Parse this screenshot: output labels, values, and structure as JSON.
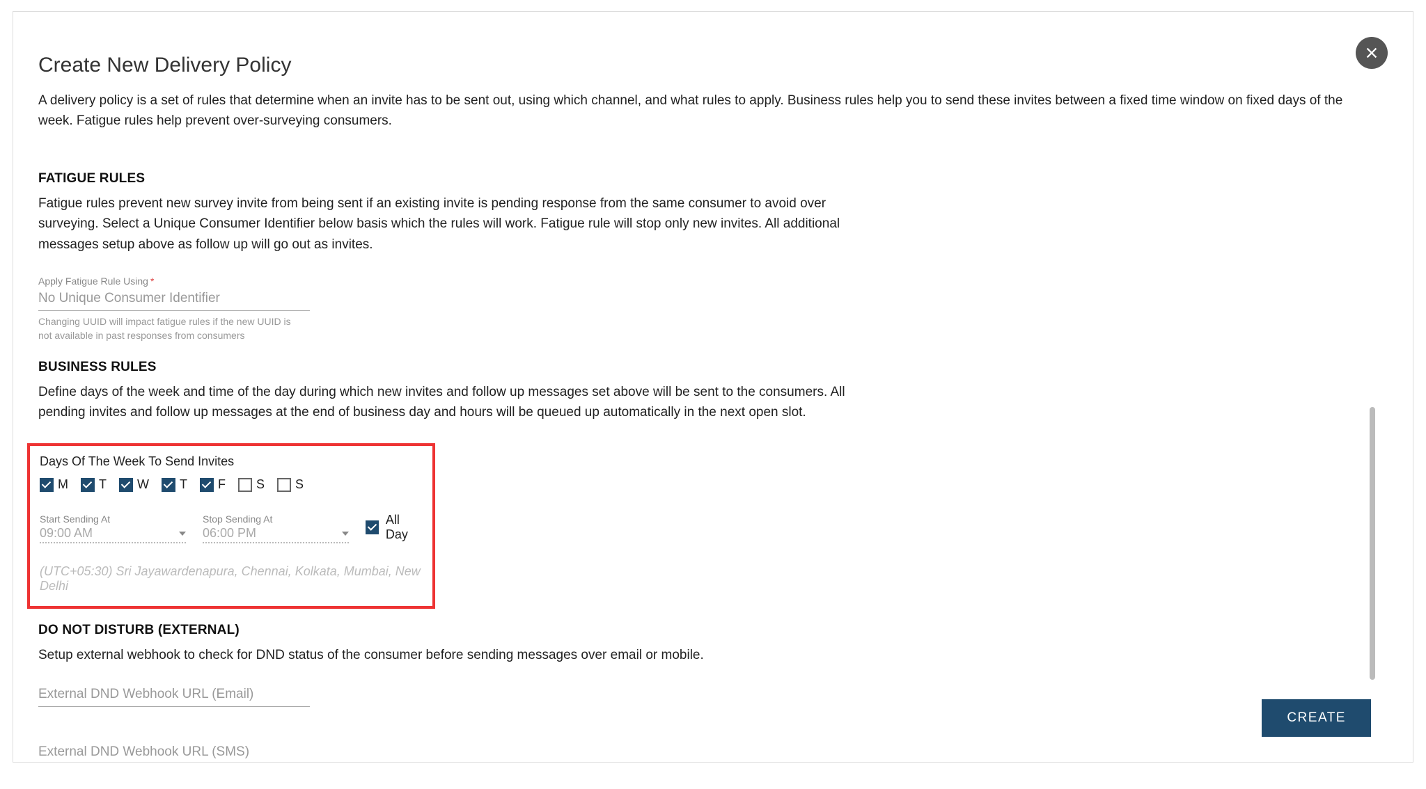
{
  "header": {
    "title": "Create New Delivery Policy",
    "description": "A delivery policy is a set of rules that determine when an invite has to be sent out, using which channel, and what rules to apply. Business rules help you to send these invites between a fixed time window on fixed days of the week. Fatigue rules help prevent over-surveying consumers."
  },
  "fatigue": {
    "heading": "FATIGUE RULES",
    "description": "Fatigue rules prevent new survey invite from being sent if an existing invite is pending response from the same consumer to avoid over surveying. Select a Unique Consumer Identifier below basis which the rules will work. Fatigue rule will stop only new invites. All additional messages setup above as follow up will go out as invites.",
    "field_label": "Apply Fatigue Rule Using",
    "field_value": "No Unique Consumer Identifier",
    "helper": "Changing UUID will impact fatigue rules if the new UUID is not available in past responses from consumers"
  },
  "business": {
    "heading": "BUSINESS RULES",
    "description": "Define days of the week and time of the day during which new invites and follow up messages set above will be sent to the consumers. All pending invites and follow up messages at the end of business day and hours will be queued up automatically in the next open slot.",
    "days_label": "Days Of The Week To Send Invites",
    "days": [
      {
        "label": "M",
        "checked": true
      },
      {
        "label": "T",
        "checked": true
      },
      {
        "label": "W",
        "checked": true
      },
      {
        "label": "T",
        "checked": true
      },
      {
        "label": "F",
        "checked": true
      },
      {
        "label": "S",
        "checked": false
      },
      {
        "label": "S",
        "checked": false
      }
    ],
    "start_label": "Start Sending At",
    "start_value": "09:00 AM",
    "stop_label": "Stop Sending At",
    "stop_value": "06:00 PM",
    "all_day_label": "All Day",
    "all_day_checked": true,
    "timezone": "(UTC+05:30) Sri Jayawardenapura, Chennai, Kolkata, Mumbai, New Delhi"
  },
  "dnd": {
    "heading": "DO NOT DISTURB (EXTERNAL)",
    "description": "Setup external webhook to check for DND status of the consumer before sending messages over email or mobile.",
    "email_placeholder": "External DND Webhook URL (Email)",
    "sms_placeholder": "External DND Webhook URL (SMS)"
  },
  "footer": {
    "create_label": "CREATE"
  }
}
